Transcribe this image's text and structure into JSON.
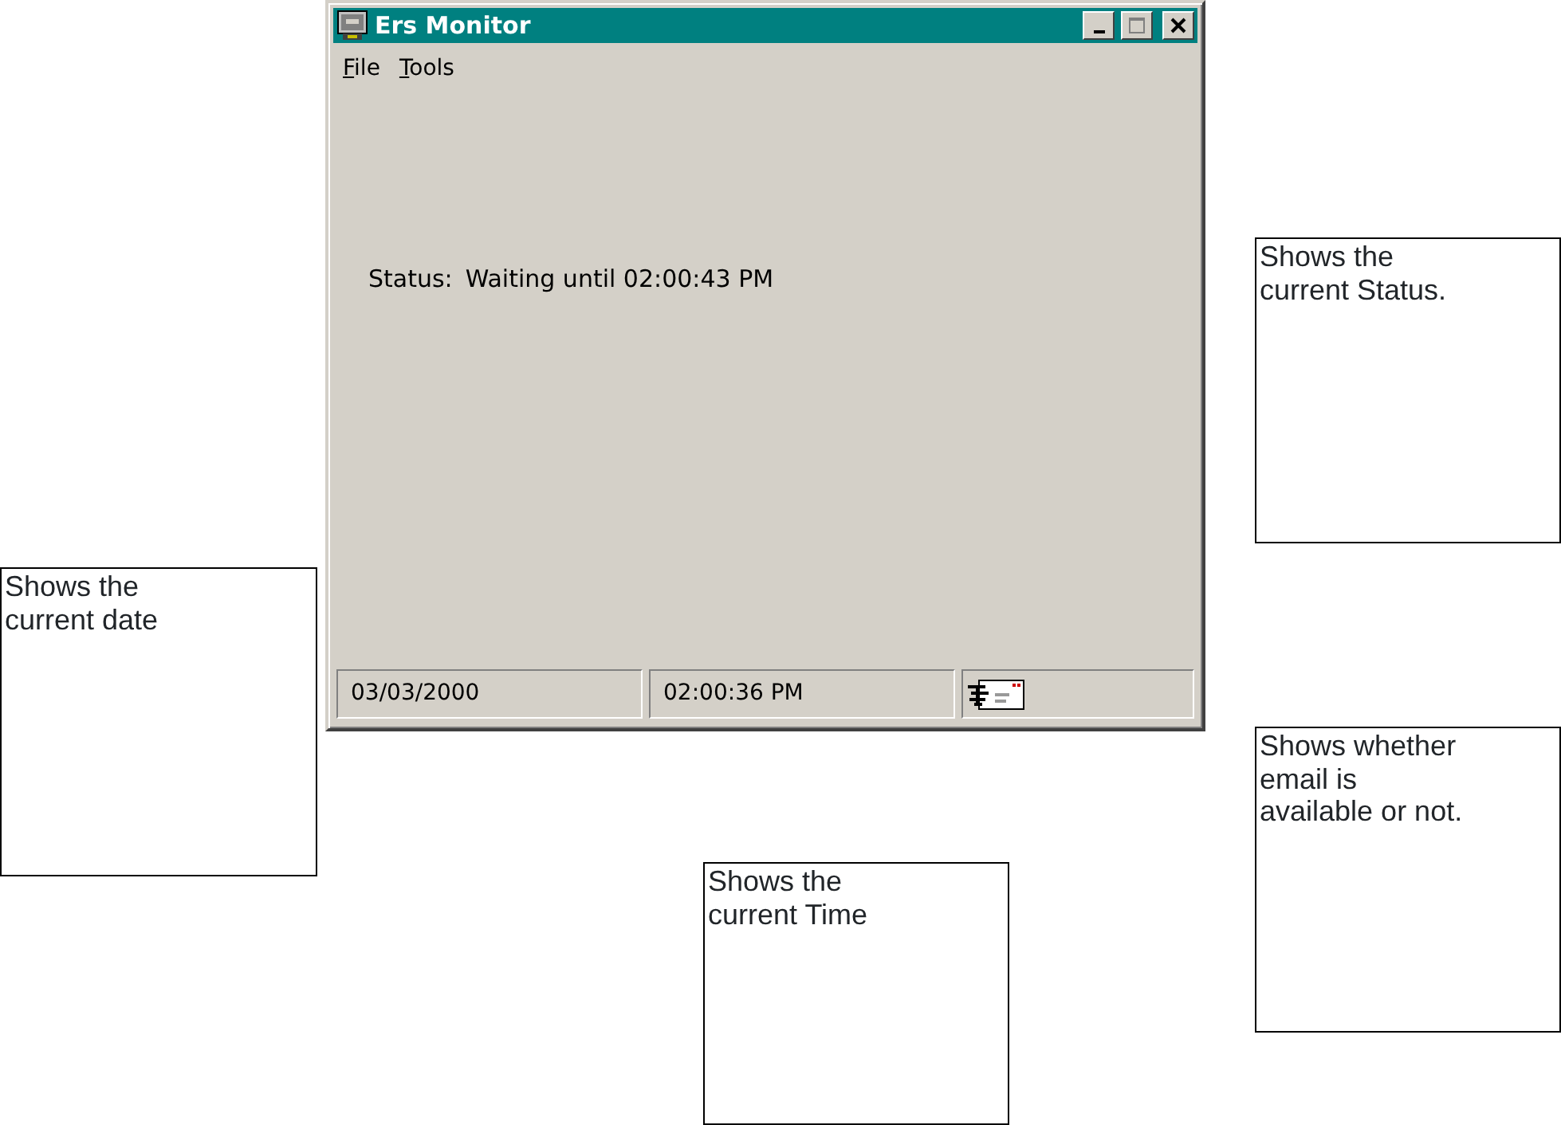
{
  "window": {
    "title": "Ers Monitor",
    "controls": [
      {
        "kind": "minimize",
        "disabled": false
      },
      {
        "kind": "maximize",
        "disabled": true
      },
      {
        "kind": "close",
        "disabled": false
      }
    ]
  },
  "menu": [
    {
      "label": "File",
      "first_letter_underlined": true
    },
    {
      "label": "Tools",
      "first_letter_underlined": true
    }
  ],
  "status": {
    "label": "Status:",
    "value": "Waiting until 02:00:43 PM"
  },
  "status_bar": [
    {
      "kind": "text",
      "text": "03/03/2000"
    },
    {
      "kind": "text",
      "text": "02:00:36 PM"
    },
    {
      "kind": "mail"
    }
  ],
  "callouts": [
    {
      "lines": [
        "Shows the",
        "current Status."
      ]
    },
    {
      "lines": [
        "Shows the",
        "current date"
      ]
    },
    {
      "lines": [
        "Shows whether",
        "email is",
        "available or not."
      ]
    },
    {
      "lines": [
        "Shows the",
        "current Time"
      ]
    }
  ]
}
